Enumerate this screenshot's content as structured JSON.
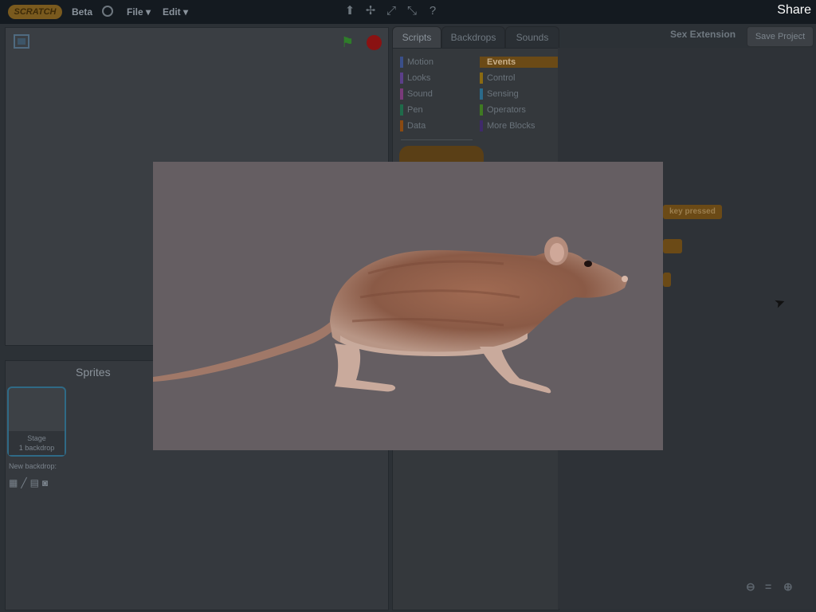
{
  "menubar": {
    "logo": "SCRATCH",
    "beta": "Beta",
    "file": "File ▾",
    "edit": "Edit ▾",
    "share": "Share",
    "tool_icons": [
      "duplicate-stamp-icon",
      "delete-cut-icon",
      "grow-icon",
      "shrink-icon",
      "help-icon"
    ]
  },
  "stage": {
    "flag_icon": "green-flag-icon",
    "stop_icon": "stop-sign-icon"
  },
  "sprites": {
    "header": "Sprites",
    "stage_label_1": "Stage",
    "stage_label_2": "1 backdrop",
    "new_backdrop": "New backdrop:"
  },
  "tabs": [
    "Scripts",
    "Backdrops",
    "Sounds"
  ],
  "extension_title": "Sex Extension",
  "save_button": "Save Project",
  "categories_left": [
    "Motion",
    "Looks",
    "Sound",
    "Pen",
    "Data"
  ],
  "categories_right": [
    "Events",
    "Control",
    "Sensing",
    "Operators",
    "More Blocks"
  ],
  "category_colors": {
    "Motion": "#3a4f8a",
    "Looks": "#5b3f8a",
    "Sound": "#7a3a7a",
    "Pen": "#1f6b4a",
    "Data": "#8a4a12",
    "Events": "#6b4a16",
    "Control": "#8a6a12",
    "Sensing": "#2a6a8a",
    "Operators": "#3f7a22",
    "More Blocks": "#3f2a6a"
  },
  "script_blocks": {
    "key_pressed": "key pressed"
  },
  "lightbox": {
    "background": "#655e62",
    "image_subject": "rat-image"
  }
}
